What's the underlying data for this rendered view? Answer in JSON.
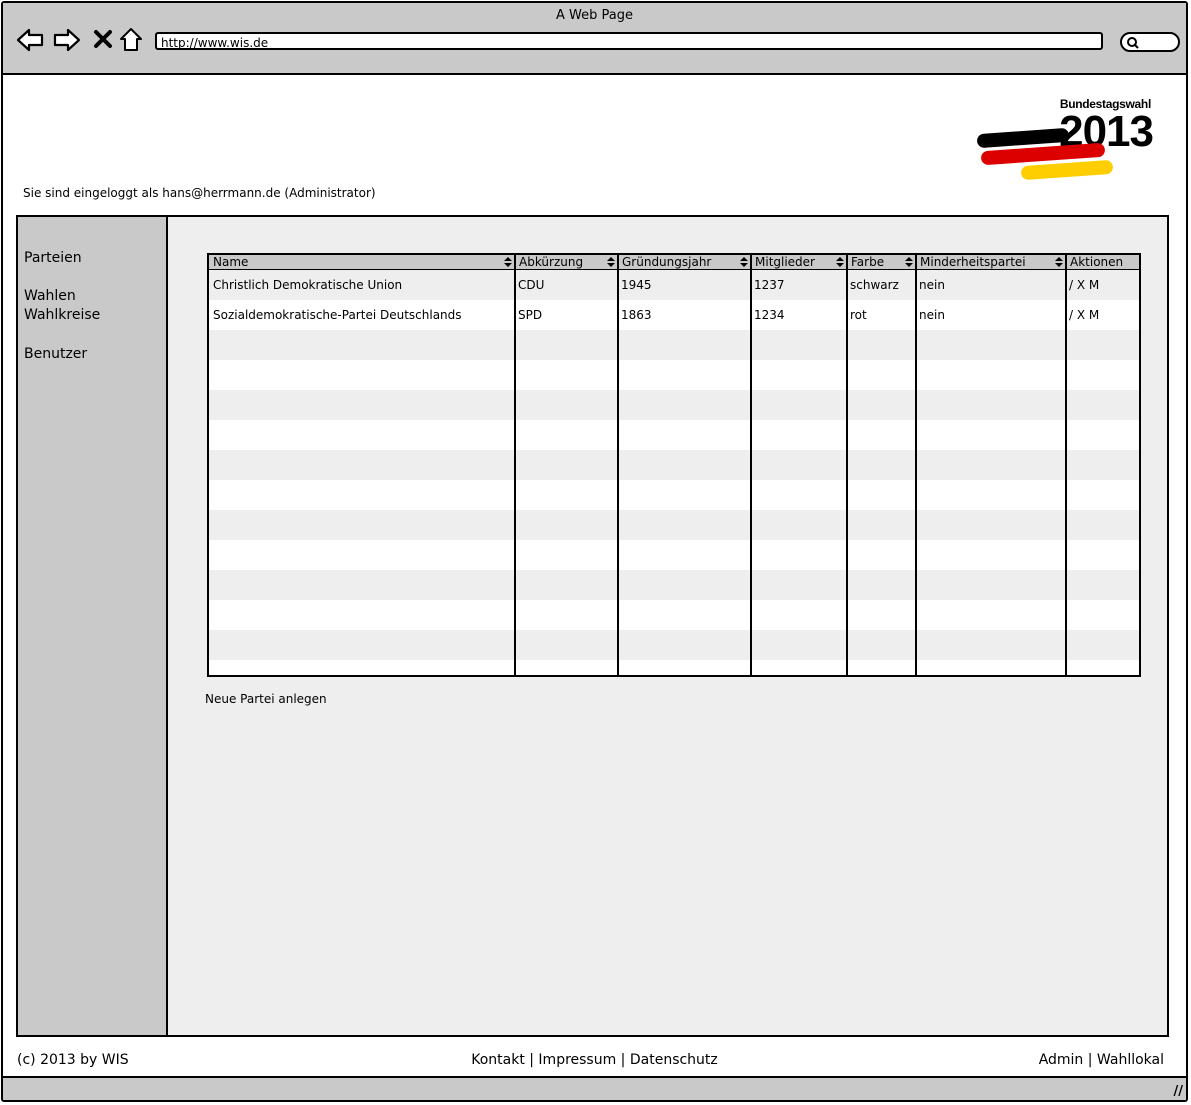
{
  "window": {
    "title": "A Web Page",
    "url": "http://www.wis.de"
  },
  "logo": {
    "subtitle": "Bundestagswahl",
    "year": "2013",
    "flag_colors": [
      "#000000",
      "#dd0000",
      "#ffce00"
    ]
  },
  "session": {
    "text": "Sie sind eingeloggt als hans@herrmann.de (Administrator)"
  },
  "sidebar": {
    "items": [
      {
        "label": "Parteien"
      },
      {
        "label": "Wahlen"
      },
      {
        "label": "Wahlkreise"
      },
      {
        "label": "Benutzer"
      }
    ]
  },
  "table": {
    "columns": [
      {
        "label": "Name"
      },
      {
        "label": "Abkürzung"
      },
      {
        "label": "Gründungsjahr"
      },
      {
        "label": "Mitglieder"
      },
      {
        "label": "Farbe"
      },
      {
        "label": "Minderheitspartei"
      },
      {
        "label": "Aktionen"
      }
    ],
    "rows": [
      {
        "name": "Christlich Demokratische Union",
        "abbr": "CDU",
        "year": "1945",
        "members": "1237",
        "color": "schwarz",
        "minority": "nein",
        "actions": "/ X M"
      },
      {
        "name": "Sozialdemokratische-Partei Deutschlands",
        "abbr": "SPD",
        "year": "1863",
        "members": "1234",
        "color": "rot",
        "minority": "nein",
        "actions": "/ X M"
      }
    ]
  },
  "actions": {
    "new_party": "Neue Partei anlegen"
  },
  "footer": {
    "left": "(c) 2013 by WIS",
    "center": "Kontakt | Impressum | Datenschutz",
    "right": "Admin | Wahllokal"
  },
  "colors": {
    "chrome": "#c9c9c9",
    "content_bg": "#eeeeee",
    "row_alt": "#eeeeee"
  }
}
